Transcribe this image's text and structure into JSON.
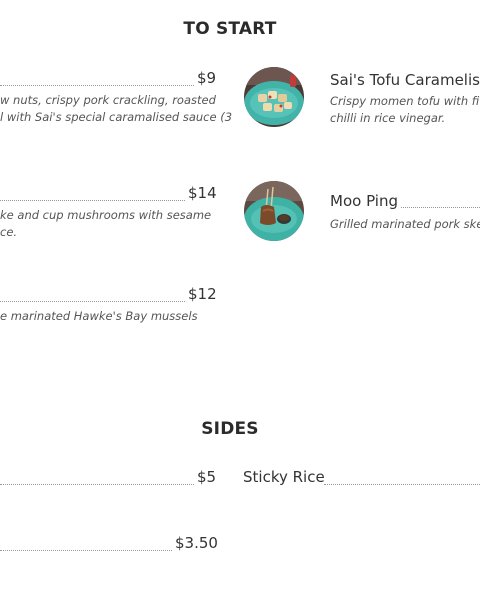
{
  "sections": {
    "to_start": "TO START",
    "sides": "SIDES"
  },
  "left_items": [
    {
      "price": "$9",
      "desc_line1": "w nuts, crispy pork crackling, roasted",
      "desc_line2": "l with Sai's special caramalised sauce (3"
    },
    {
      "price": "$14",
      "desc_line1": "ke and cup mushrooms with sesame",
      "desc_line2": "ce."
    },
    {
      "price": "$12",
      "desc_line1": "e marinated Hawke's Bay mussels"
    }
  ],
  "right_items": [
    {
      "name": "Sai's Tofu Caramelised",
      "desc_line1": "Crispy momen tofu with five",
      "desc_line2": "chilli in rice vinegar."
    },
    {
      "name": "Moo Ping",
      "desc_line1": "Grilled marinated pork skew"
    }
  ],
  "sides": {
    "left_prices": [
      "$5",
      "$3.50"
    ],
    "right_item": "Sticky Rice"
  },
  "colors": {
    "text": "#333333",
    "plate": "#3fb2a6"
  }
}
